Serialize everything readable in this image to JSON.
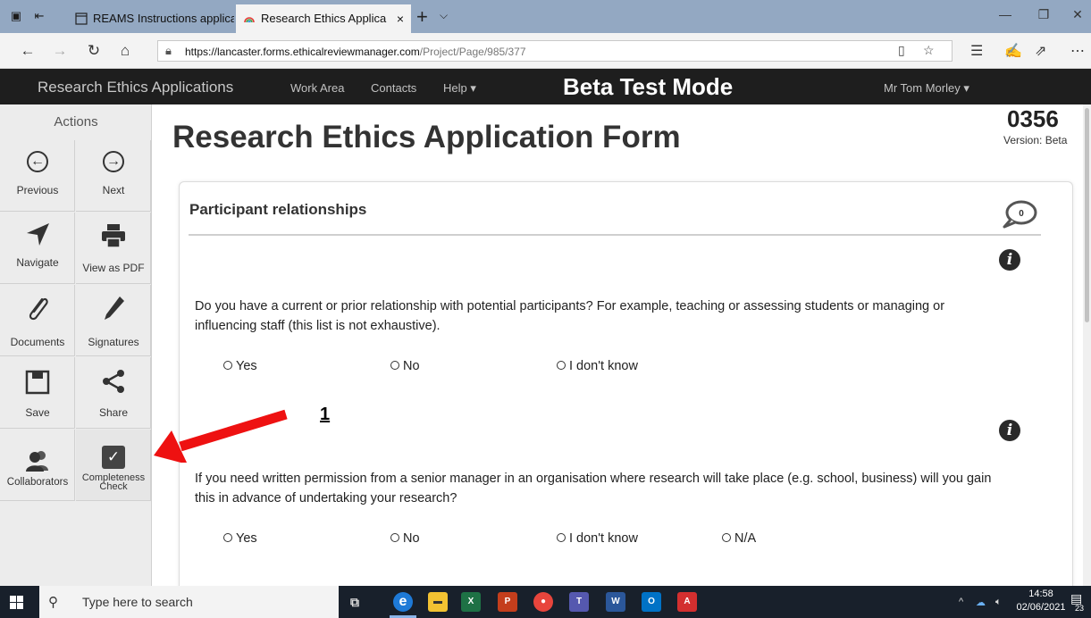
{
  "browser": {
    "tabs": [
      {
        "title": "REAMS Instructions applicat",
        "icon": "document-icon",
        "active": false
      },
      {
        "title": "Research Ethics Applica",
        "icon": "rainbow-favicon",
        "active": true
      }
    ],
    "new_tab": "+",
    "tab_close": "×",
    "url_host": "https://lancaster.forms.ethicalreviewmanager.com",
    "url_path": "/Project/Page/985/377"
  },
  "site": {
    "brand": "Research Ethics Applications",
    "nav": [
      "Work Area",
      "Contacts",
      "Help ▾"
    ],
    "mode_banner": "Beta Test Mode",
    "user": "Mr Tom Morley ▾"
  },
  "sidebar": {
    "title": "Actions",
    "items": [
      {
        "label": "Previous",
        "icon": "previous-icon"
      },
      {
        "label": "Next",
        "icon": "next-icon"
      },
      {
        "label": "Navigate",
        "icon": "navigate-icon"
      },
      {
        "label": "View as PDF",
        "icon": "print-icon"
      },
      {
        "label": "Documents",
        "icon": "paperclip-icon"
      },
      {
        "label": "Signatures",
        "icon": "pen-icon"
      },
      {
        "label": "Save",
        "icon": "save-icon"
      },
      {
        "label": "Share",
        "icon": "share-icon"
      },
      {
        "label": "Collaborators",
        "icon": "collaborators-icon"
      },
      {
        "label": "Completeness",
        "label2": "Check",
        "icon": "checkbox-icon"
      }
    ]
  },
  "main": {
    "title": "Research Ethics Application Form",
    "ref_number": "0356",
    "version": "Version: Beta",
    "section_title": "Participant relationships",
    "comment_count": "0",
    "questions": [
      {
        "text": "Do you have a current or prior relationship with potential participants? For example, teaching or assessing students or managing or influencing staff (this list is not exhaustive).",
        "options": [
          "Yes",
          "No",
          "I don't know"
        ]
      },
      {
        "text": "If you need written permission from a senior manager in an organisation where research will take place (e.g. school, business) will you gain this in advance of undertaking your research?",
        "options": [
          "Yes",
          "No",
          "I don't know",
          "N/A"
        ]
      }
    ],
    "annotation_number": "1",
    "annotation_color": "#ee1111"
  },
  "taskbar": {
    "search_placeholder": "Type here to search",
    "time": "14:58",
    "date": "02/06/2021",
    "notification_count": "23"
  }
}
